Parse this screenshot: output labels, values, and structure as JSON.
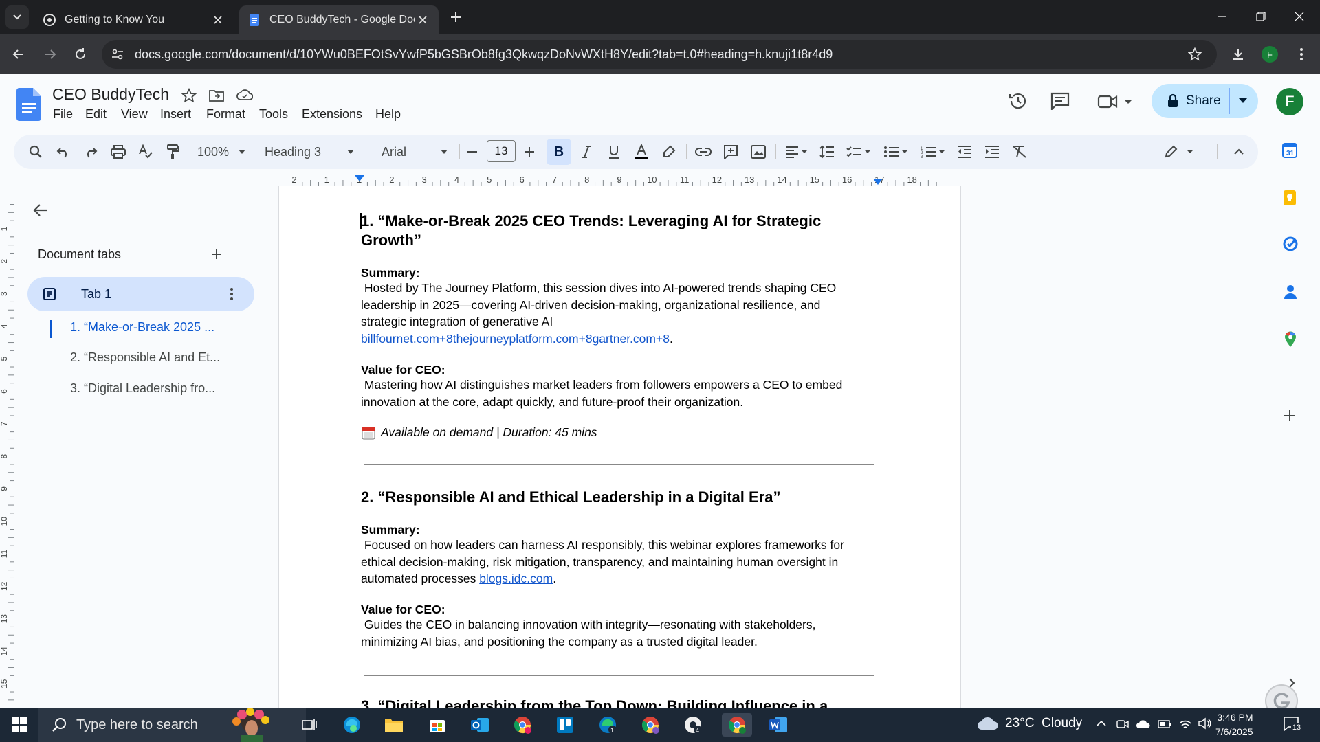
{
  "browser": {
    "tabs": [
      {
        "title": "Getting to Know You",
        "active": false
      },
      {
        "title": "CEO BuddyTech - Google Docs",
        "active": true
      }
    ],
    "url": "docs.google.com/document/d/10YWu0BEFOtSvYwfP5bGSBrOb8fg3QkwqzDoNvWXtH8Y/edit?tab=t.0#heading=h.knuji1t8r4d9",
    "profile_initial": "F"
  },
  "docs": {
    "title": "CEO BuddyTech",
    "menu": [
      "File",
      "Edit",
      "View",
      "Insert",
      "Format",
      "Tools",
      "Extensions",
      "Help"
    ],
    "share_label": "Share",
    "avatar_initial": "F"
  },
  "toolbar": {
    "zoom": "100%",
    "style": "Heading 3",
    "font": "Arial",
    "font_size": "13",
    "bold": "B"
  },
  "ruler": {
    "labels": [
      "2",
      "1",
      "1",
      "2",
      "3",
      "4",
      "5",
      "6",
      "7",
      "8",
      "9",
      "10",
      "11",
      "12",
      "13",
      "14",
      "15",
      "16",
      "17",
      "18"
    ],
    "vlabels": [
      "1",
      "2",
      "3",
      "4",
      "5",
      "6",
      "7",
      "8",
      "9",
      "10",
      "11",
      "12",
      "13",
      "14",
      "15"
    ]
  },
  "sidebar": {
    "heading": "Document tabs",
    "tab_label": "Tab 1",
    "outline": [
      "1. “Make-or-Break 2025 ...",
      "2. “Responsible AI and Et...",
      "3. “Digital Leadership fro..."
    ]
  },
  "document": {
    "sections": [
      {
        "heading_line1": "1. “Make-or-Break 2025 CEO Trends: Leveraging AI for Strategic",
        "heading_line2": "Growth”",
        "summary_label": "Summary:",
        "summary_lines": [
          " Hosted by The Journey Platform, this session dives into AI-powered trends shaping CEO",
          "leadership in 2025—covering AI-driven decision-making, organizational resilience, and",
          "strategic integration of generative AI"
        ],
        "summary_link": "billfournet.com+8thejourneyplatform.com+8gartner.com+8",
        "value_label": "Value for CEO:",
        "value_lines": [
          " Mastering how AI distinguishes market leaders from followers empowers a CEO to embed",
          "innovation at the core, adapt quickly, and future-proof their organization."
        ],
        "availability": "Available on demand | Duration: 45 mins"
      },
      {
        "heading_line1": "2. “Responsible AI and Ethical Leadership in a Digital Era”",
        "summary_label": "Summary:",
        "summary_lines": [
          " Focused on how leaders can harness AI responsibly, this webinar explores frameworks for",
          "ethical decision-making, risk mitigation, transparency, and maintaining human oversight in"
        ],
        "summary_last_prefix": "automated processes ",
        "summary_link": "blogs.idc.com",
        "value_label": "Value for CEO:",
        "value_lines": [
          " Guides the CEO in balancing innovation with integrity—resonating with stakeholders,",
          "minimizing AI bias, and positioning the company as a trusted digital leader."
        ]
      },
      {
        "heading_line1": "3. “Digital Leadership from the Top Down: Building Influence in a"
      }
    ]
  },
  "taskbar": {
    "search_placeholder": "Type here to search",
    "weather": "23°C  Cloudy",
    "time": "3:46 PM",
    "date": "7/6/2025",
    "notifications": "13"
  },
  "colors": {
    "accent": "#0b57d0",
    "share_bg": "#c2e7ff",
    "link": "#1155cc",
    "chrome_dark": "#1e1f22"
  }
}
